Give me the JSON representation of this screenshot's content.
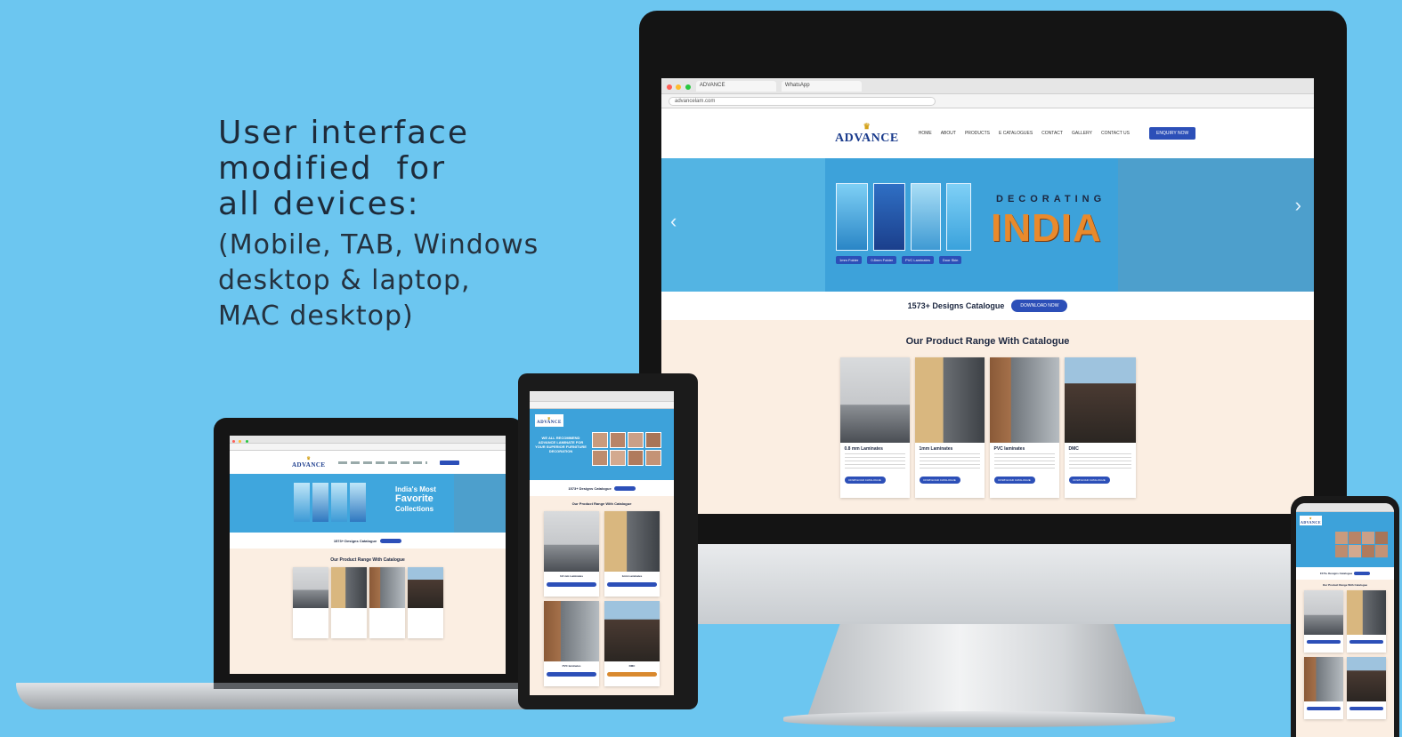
{
  "headline": {
    "line1": "User interface",
    "line2": "modified  for",
    "line3": "all devices:",
    "sub1": "(Mobile, TAB, Windows",
    "sub2": "desktop & laptop,",
    "sub3": "MAC desktop)"
  },
  "site": {
    "logo": "ADVANCE",
    "nav": [
      "HOME",
      "ABOUT",
      "PRODUCTS",
      "E CATALOGUES",
      "CONTACT",
      "GALLERY",
      "CONTACT US"
    ],
    "cta_button": "ENQUIRY NOW",
    "hero_title": "DECORATING",
    "hero_title2": "INDIA",
    "hero_product_labels": [
      "1mm Folder",
      "0.8mm Folder",
      "PVC Laminates",
      "Door Skin"
    ],
    "catalogue_text": "1573+ Designs Catalogue",
    "download_button": "DOWNLOAD NOW",
    "range_title": "Our Product Range With Catalogue",
    "products": [
      {
        "title": "0.8 mm Laminates",
        "button": "DOWNLOAD CATALOGUE"
      },
      {
        "title": "1mm Laminates",
        "button": "DOWNLOAD CATALOGUE"
      },
      {
        "title": "PVC laminates",
        "button": "DOWNLOAD CATALOGUE"
      },
      {
        "title": "DMC",
        "button": "DOWNLOAD CATALOGUE"
      }
    ],
    "laptop_hero_title": "India's Most",
    "laptop_hero_title2": "Favorite",
    "laptop_hero_title3": "Collections",
    "mobile_hero_text": "WE ALL RECOMMEND ADVANCE LAMINATE FOR YOUR SUPERIOR FURNITURE DECORATION",
    "chevron_left": "‹",
    "chevron_right": "›"
  },
  "colors": {
    "background": "#6cc6f0",
    "brand_blue": "#2c4fb8",
    "hero_blue": "#3fa6dd",
    "range_bg": "#fbeee2"
  }
}
